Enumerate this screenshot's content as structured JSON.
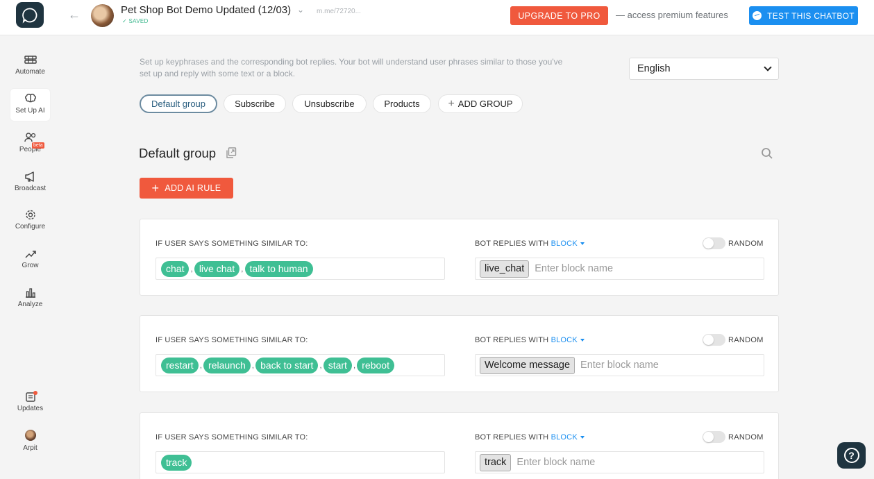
{
  "header": {
    "bot_title": "Pet Shop Bot Demo Updated (12/03)",
    "saved_status": "SAVED",
    "bot_url": "m.me/72720...",
    "upgrade_label": "UPGRADE TO PRO",
    "premium_text": "— access premium features",
    "test_label": "TEST THIS CHATBOT"
  },
  "sidebar": {
    "items": [
      {
        "label": "Automate",
        "icon": "automate-icon"
      },
      {
        "label": "Set Up AI",
        "icon": "ai-brain-icon",
        "active": true
      },
      {
        "label": "People",
        "icon": "people-icon",
        "badge": "beta"
      },
      {
        "label": "Broadcast",
        "icon": "megaphone-icon"
      },
      {
        "label": "Configure",
        "icon": "gear-icon"
      },
      {
        "label": "Grow",
        "icon": "grow-chart-icon"
      },
      {
        "label": "Analyze",
        "icon": "bar-chart-icon"
      }
    ],
    "updates_label": "Updates",
    "user_label": "Arpit"
  },
  "main": {
    "intro": "Set up keyphrases and the corresponding bot replies. Your bot will understand user phrases similar to those you've set up and reply with some text or a block.",
    "language": "English",
    "groups": [
      "Default group",
      "Subscribe",
      "Unsubscribe",
      "Products"
    ],
    "add_group_label": "ADD GROUP",
    "group_title": "Default group",
    "add_rule_label": "ADD AI RULE",
    "rule_user_label": "IF USER SAYS SOMETHING SIMILAR TO:",
    "rule_bot_label": "BOT REPLIES WITH",
    "rule_block_word": "BLOCK",
    "random_label": "RANDOM",
    "block_placeholder": "Enter block name",
    "rules": [
      {
        "phrases": [
          "chat",
          "live chat",
          "talk to human"
        ],
        "block": "live_chat"
      },
      {
        "phrases": [
          "restart",
          "relaunch",
          "back to start",
          "start",
          "reboot"
        ],
        "block": "Welcome message"
      },
      {
        "phrases": [
          "track"
        ],
        "block": "track"
      }
    ]
  },
  "colors": {
    "accent_orange": "#f0593d",
    "messenger_blue": "#1b8ff0",
    "phrase_green": "#3fbf94",
    "dark_navy": "#1f3440"
  }
}
